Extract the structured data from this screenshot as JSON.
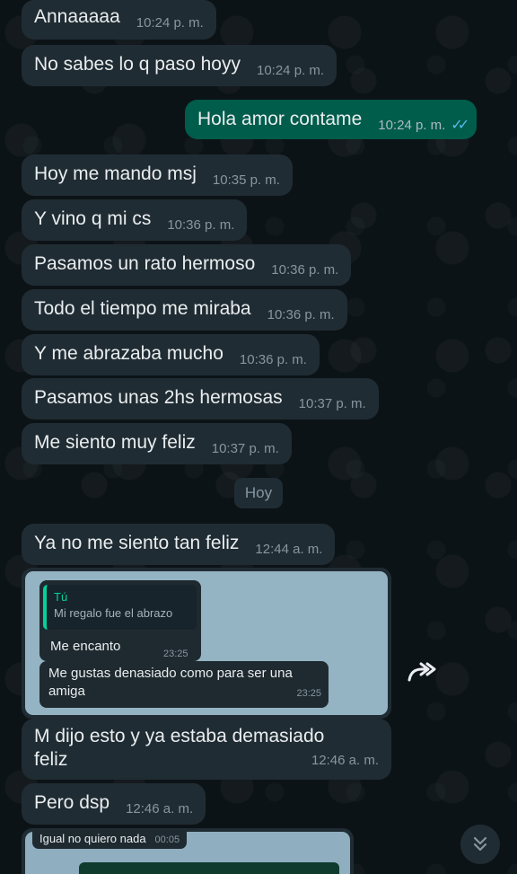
{
  "messages": [
    {
      "text": "Annaaaaa",
      "time": "10:24 p. m.",
      "direction": "in"
    },
    {
      "text": "No sabes lo q paso hoyy",
      "time": "10:24 p. m.",
      "direction": "in"
    },
    {
      "text": "Hola amor contame",
      "time": "10:24 p. m.",
      "direction": "out",
      "status": "read"
    },
    {
      "text": "Hoy me mando msj",
      "time": "10:35 p. m.",
      "direction": "in"
    },
    {
      "text": "Y vino q mi cs",
      "time": "10:36 p. m.",
      "direction": "in"
    },
    {
      "text": "Pasamos un rato hermoso",
      "time": "10:36 p. m.",
      "direction": "in"
    },
    {
      "text": "Todo el tiempo me miraba",
      "time": "10:36 p. m.",
      "direction": "in"
    },
    {
      "text": "Y me abrazaba mucho",
      "time": "10:36 p. m.",
      "direction": "in"
    },
    {
      "text": "Pasamos unas 2hs hermosas",
      "time": "10:37 p. m.",
      "direction": "in"
    },
    {
      "text": "Me siento muy feliz",
      "time": "10:37 p. m.",
      "direction": "in"
    }
  ],
  "day_separator": "Hoy",
  "after_day": {
    "text": "Ya no me siento tan feliz",
    "time": "12:44 a. m."
  },
  "image_message": {
    "quote_author": "Tú",
    "quote_text": "Mi regalo fue el abrazo",
    "reply_text": "Me encanto",
    "reply_time": "23:25",
    "second_text_line1": "Me gustas denasiado como para ser una",
    "second_text_line2": "amiga",
    "second_time": "23:25"
  },
  "long_message": {
    "line1": "M dijo esto y ya estaba demasiado",
    "line2": "feliz",
    "time": "12:46 a. m."
  },
  "last_message": {
    "text": "Pero dsp",
    "time": "12:46 a. m."
  },
  "bottom_image": {
    "text": "Igual no quiero nada",
    "time": "00:05"
  },
  "icons": {
    "read_receipt": "double-check-icon",
    "forward": "forward-icon",
    "scroll_down": "chevron-double-down-icon"
  },
  "colors": {
    "incoming": "#202c33",
    "outgoing": "#005c4b",
    "read_tick": "#53bdeb",
    "quote_accent": "#06cf9c"
  }
}
